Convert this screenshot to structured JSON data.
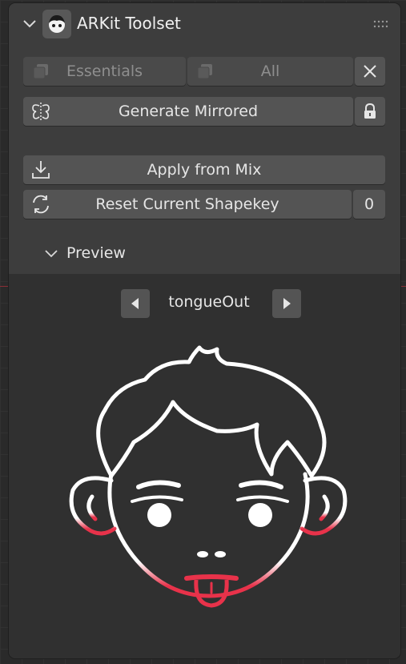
{
  "panel": {
    "title": "ARKit Toolset"
  },
  "buttons": {
    "essentials": "Essentials",
    "all": "All",
    "generate_mirrored": "Generate Mirrored",
    "apply_from_mix": "Apply from Mix",
    "reset_shapekey": "Reset Current Shapekey",
    "reset_value": "0"
  },
  "preview": {
    "title": "Preview",
    "shape_name": "tongueOut"
  },
  "colors": {
    "accent": "#e8324a"
  },
  "icons": [
    "chevron-down-icon",
    "addon-face-icon",
    "drag-handle-icon",
    "shapekey-icon",
    "close-icon",
    "mirror-icon",
    "lock-icon",
    "download-icon",
    "refresh-icon",
    "arrow-left-icon",
    "arrow-right-icon"
  ]
}
